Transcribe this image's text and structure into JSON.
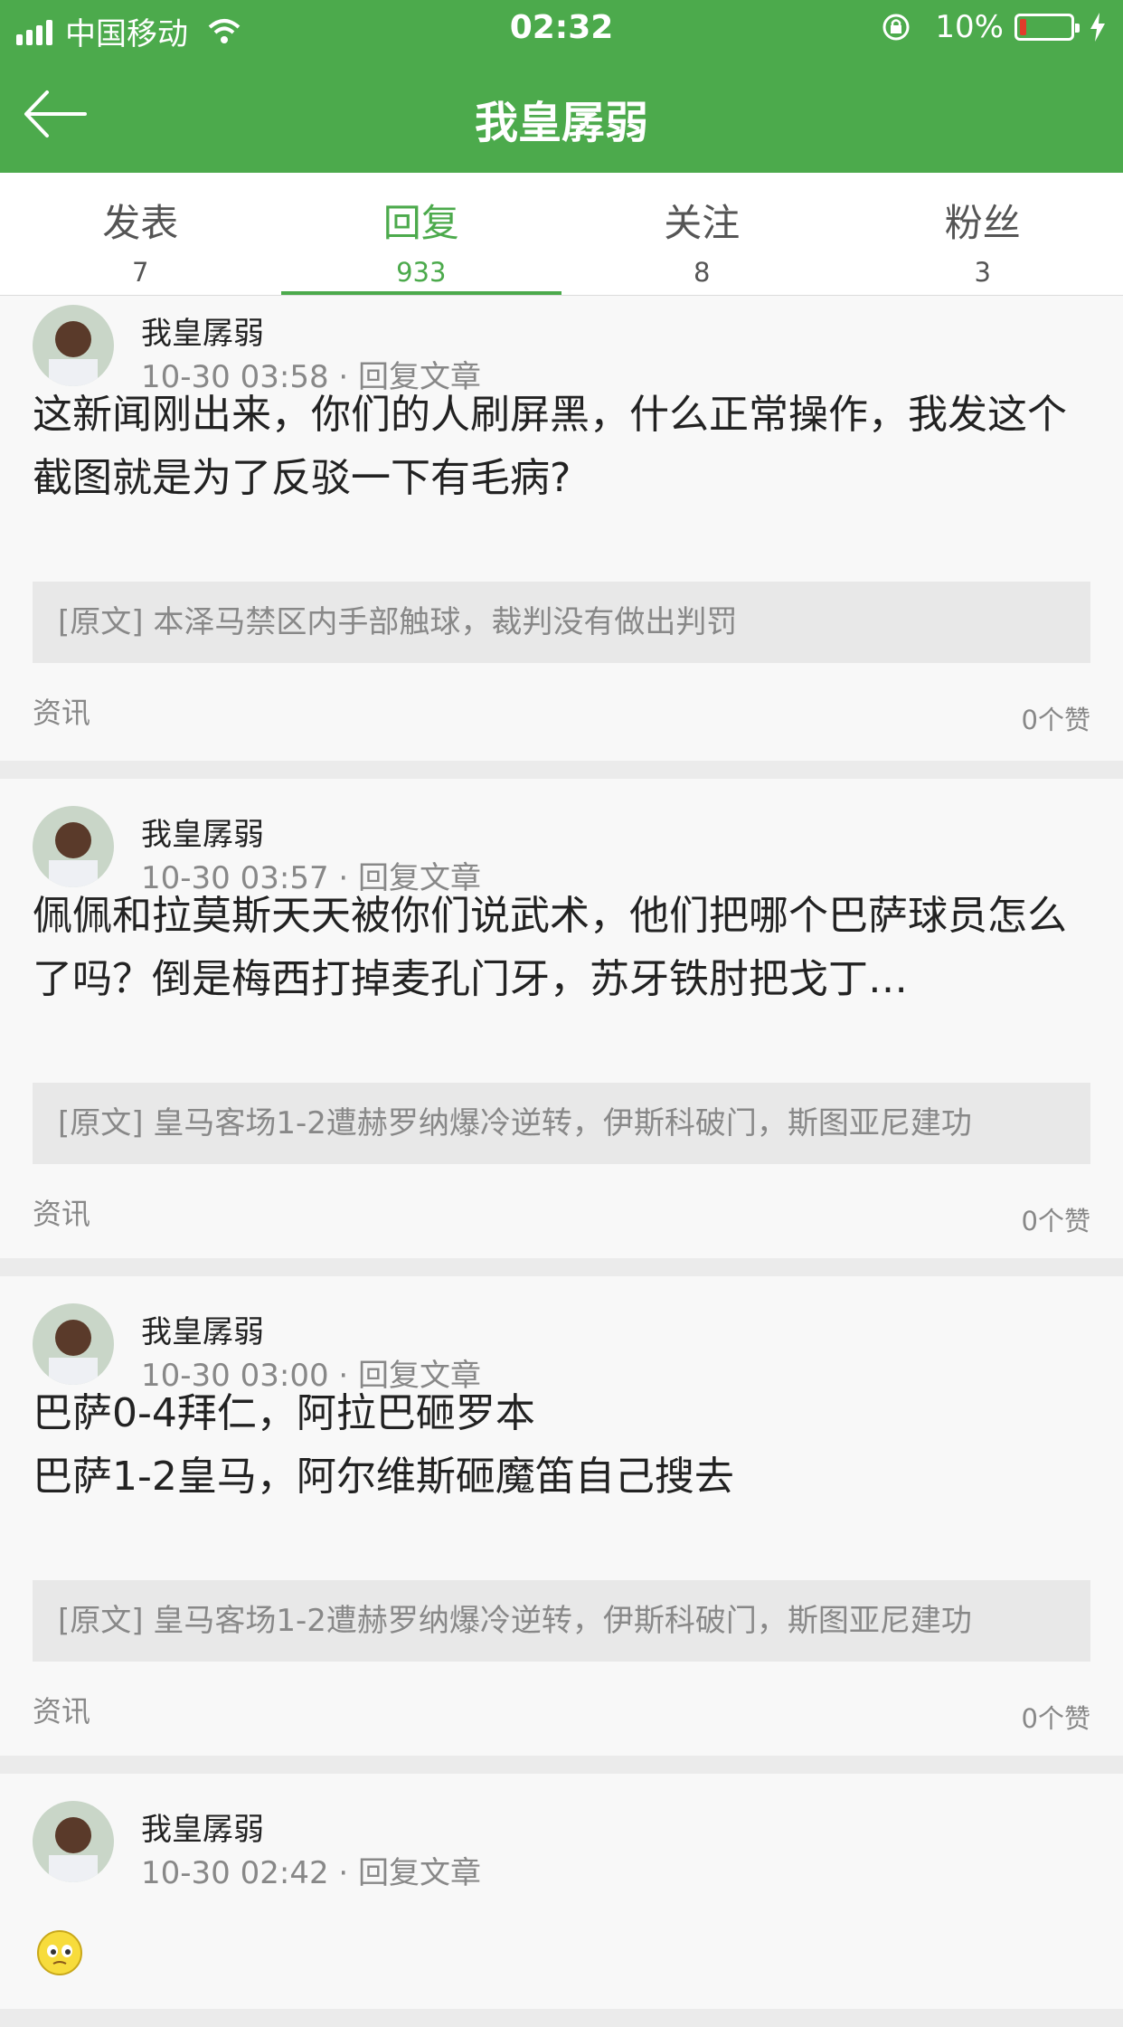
{
  "status": {
    "carrier": "中国移动",
    "time": "02:32",
    "battery": "10%"
  },
  "header": {
    "title": "我皇孱弱"
  },
  "tabs": [
    {
      "label": "发表",
      "count": "7"
    },
    {
      "label": "回复",
      "count": "933"
    },
    {
      "label": "关注",
      "count": "8"
    },
    {
      "label": "粉丝",
      "count": "3"
    }
  ],
  "posts": [
    {
      "author": "我皇孱弱",
      "time": "10-30 03:58",
      "action": "回复文章",
      "body": "这新闻刚出来，你们的人刷屏黑，什么正常操作，我发这个截图就是为了反驳一下有毛病?",
      "original": "[原文] 本泽马禁区内手部触球，裁判没有做出判罚",
      "category": "资讯",
      "likes": "0个赞"
    },
    {
      "author": "我皇孱弱",
      "time": "10-30 03:57",
      "action": "回复文章",
      "body": "佩佩和拉莫斯天天被你们说武术，他们把哪个巴萨球员怎么了吗？倒是梅西打掉麦孔门牙，苏牙铁肘把戈丁…",
      "original": "[原文] 皇马客场1-2遭赫罗纳爆冷逆转，伊斯科破门，斯图亚尼建功",
      "category": "资讯",
      "likes": "0个赞"
    },
    {
      "author": "我皇孱弱",
      "time": "10-30 03:00",
      "action": "回复文章",
      "body": "巴萨0-4拜仁，阿拉巴砸罗本\n巴萨1-2皇马，阿尔维斯砸魔笛自己搜去",
      "original": "[原文] 皇马客场1-2遭赫罗纳爆冷逆转，伊斯科破门，斯图亚尼建功",
      "category": "资讯",
      "likes": "0个赞"
    },
    {
      "author": "我皇孱弱",
      "time": "10-30 02:42",
      "action": "回复文章"
    }
  ]
}
